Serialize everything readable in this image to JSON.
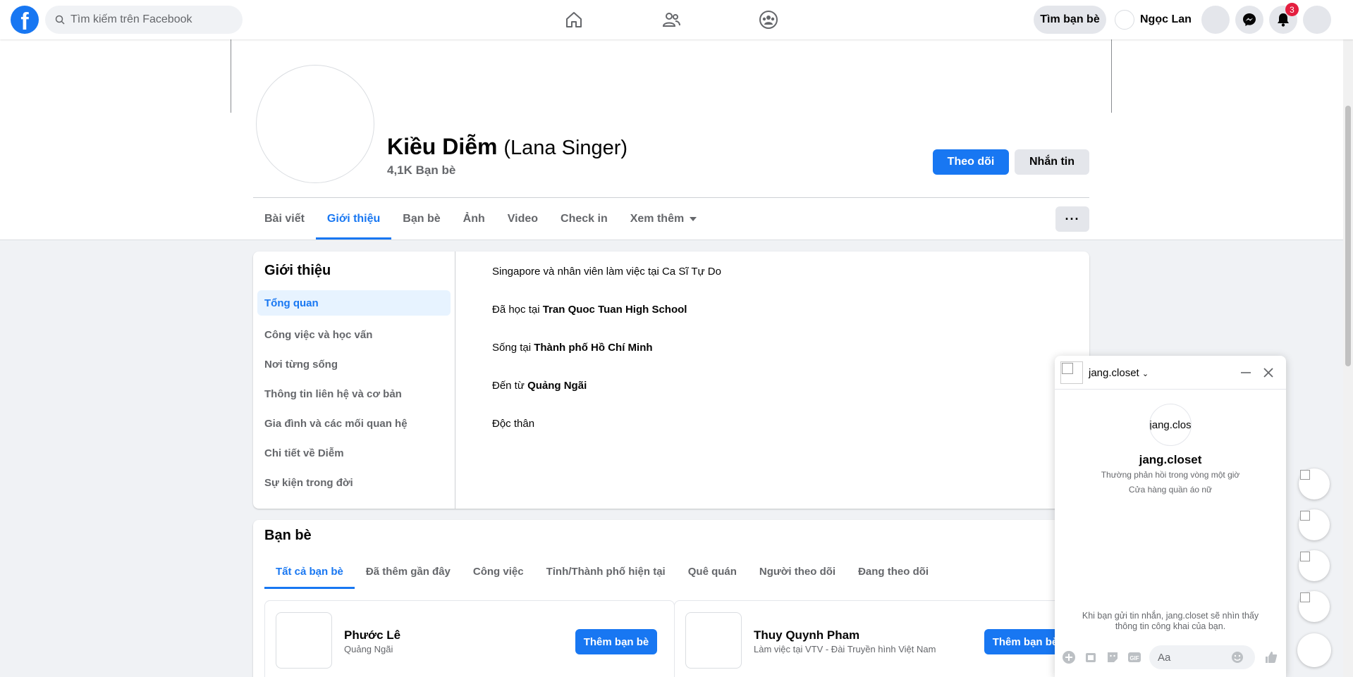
{
  "topbar": {
    "search_placeholder": "Tìm kiếm trên Facebook",
    "find_friends": "Tìm bạn bè",
    "user_name": "Ngọc Lan",
    "notif_count": "3"
  },
  "profile": {
    "name": "Kiều Diễm",
    "alt_name": "(Lana Singer)",
    "friends_count": "4,1K Bạn bè",
    "follow": "Theo dõi",
    "message": "Nhắn tin"
  },
  "tabs": [
    "Bài viết",
    "Giới thiệu",
    "Bạn bè",
    "Ảnh",
    "Video",
    "Check in",
    "Xem thêm"
  ],
  "about": {
    "title": "Giới thiệu",
    "side": [
      "Tổng quan",
      "Công việc và học vấn",
      "Nơi từng sống",
      "Thông tin liên hệ và cơ bản",
      "Gia đình và các mối quan hệ",
      "Chi tiết về Diễm",
      "Sự kiện trong đời"
    ],
    "work": "Singapore và nhân viên làm việc tại Ca Sĩ Tự Do",
    "edu_pre": "Đã học tại ",
    "edu": "Tran Quoc Tuan High School",
    "live_pre": "Sống tại ",
    "live": "Thành phố Hồ Chí Minh",
    "from_pre": "Đến từ ",
    "from": "Quảng Ngãi",
    "status": "Độc thân"
  },
  "friends": {
    "title": "Bạn bè",
    "tabs": [
      "Tất cả bạn bè",
      "Đã thêm gần đây",
      "Công việc",
      "Tỉnh/Thành phố hiện tại",
      "Quê quán",
      "Người theo dõi",
      "Đang theo dõi"
    ],
    "list": [
      {
        "name": "Phước Lê",
        "sub": "Quảng Ngãi",
        "btn": "Thêm bạn bè"
      },
      {
        "name": "Thuy Quynh Pham",
        "sub": "Làm việc tại VTV - Đài Truyền hình Việt Nam",
        "btn": "Thêm bạn bè"
      }
    ]
  },
  "chat": {
    "name": "jang.closet",
    "avatar_text": "jang.clos",
    "title": "jang.closet",
    "sub1": "Thường phản hồi trong vòng một giờ",
    "sub2": "Cửa hàng quần áo nữ",
    "note": "Khi bạn gửi tin nhắn, jang.closet sẽ nhìn thấy thông tin công khai của bạn.",
    "input_placeholder": "Aa"
  },
  "colors": {
    "accent": "#1877f2",
    "badge": "#e41e3f"
  }
}
